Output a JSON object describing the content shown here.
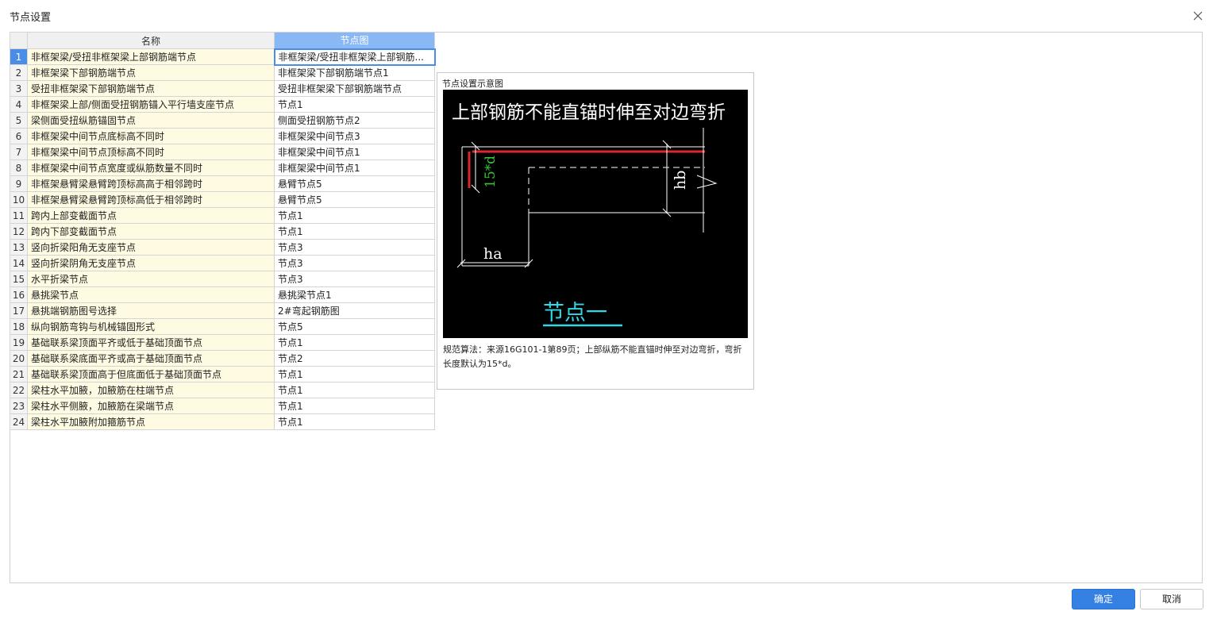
{
  "window": {
    "title": "节点设置",
    "close_icon": "close-icon"
  },
  "table": {
    "columns": [
      "名称",
      "节点图"
    ],
    "rows": [
      {
        "index": "1",
        "name": "非框架梁/受扭非框架梁上部钢筋端节点",
        "node": "非框架梁/受扭非框架梁上部钢筋..."
      },
      {
        "index": "2",
        "name": "非框架梁下部钢筋端节点",
        "node": "非框架梁下部钢筋端节点1"
      },
      {
        "index": "3",
        "name": "受扭非框架梁下部钢筋端节点",
        "node": "受扭非框架梁下部钢筋端节点"
      },
      {
        "index": "4",
        "name": "非框架梁上部/侧面受扭钢筋锚入平行墙支座节点",
        "node": "节点1"
      },
      {
        "index": "5",
        "name": "梁侧面受扭纵筋锚固节点",
        "node": "侧面受扭钢筋节点2"
      },
      {
        "index": "6",
        "name": "非框架梁中间节点底标高不同时",
        "node": "非框架梁中间节点3"
      },
      {
        "index": "7",
        "name": "非框架梁中间节点顶标高不同时",
        "node": "非框架梁中间节点1"
      },
      {
        "index": "8",
        "name": "非框架梁中间节点宽度或纵筋数量不同时",
        "node": "非框架梁中间节点1"
      },
      {
        "index": "9",
        "name": "非框架悬臂梁悬臂跨顶标高高于相邻跨时",
        "node": "悬臂节点5"
      },
      {
        "index": "10",
        "name": "非框架悬臂梁悬臂跨顶标高低于相邻跨时",
        "node": "悬臂节点5"
      },
      {
        "index": "11",
        "name": "跨内上部变截面节点",
        "node": "节点1"
      },
      {
        "index": "12",
        "name": "跨内下部变截面节点",
        "node": "节点1"
      },
      {
        "index": "13",
        "name": "竖向折梁阳角无支座节点",
        "node": "节点3"
      },
      {
        "index": "14",
        "name": "竖向折梁阴角无支座节点",
        "node": "节点3"
      },
      {
        "index": "15",
        "name": "水平折梁节点",
        "node": "节点3"
      },
      {
        "index": "16",
        "name": "悬挑梁节点",
        "node": "悬挑梁节点1"
      },
      {
        "index": "17",
        "name": "悬挑端钢筋图号选择",
        "node": "2#弯起钢筋图"
      },
      {
        "index": "18",
        "name": "纵向钢筋弯钩与机械锚固形式",
        "node": "节点5"
      },
      {
        "index": "19",
        "name": "基础联系梁顶面平齐或低于基础顶面节点",
        "node": "节点1"
      },
      {
        "index": "20",
        "name": "基础联系梁底面平齐或高于基础顶面节点",
        "node": "节点2"
      },
      {
        "index": "21",
        "name": "基础联系梁顶面高于但底面低于基础顶面节点",
        "node": "节点1"
      },
      {
        "index": "22",
        "name": "梁柱水平加腋，加腋筋在柱端节点",
        "node": "节点1"
      },
      {
        "index": "23",
        "name": "梁柱水平侧腋，加腋筋在梁端节点",
        "node": "节点1"
      },
      {
        "index": "24",
        "name": "梁柱水平加腋附加箍筋节点",
        "node": "节点1"
      }
    ]
  },
  "preview": {
    "title": "节点设置示意图",
    "diagram": {
      "heading": "上部钢筋不能直锚时伸至对边弯折",
      "label_15d": "15*d",
      "label_hb": "hb",
      "label_ha": "ha",
      "caption": "节点一",
      "colors": {
        "background": "#000000",
        "lines": "#ffffff",
        "rebar": "#e0262b",
        "dim_green": "#34c934",
        "caption": "#2fd8e6"
      }
    },
    "description": "规范算法：来源16G101-1第89页；上部纵筋不能直锚时伸至对边弯折，弯折长度默认为15*d。"
  },
  "buttons": {
    "ok": "确定",
    "cancel": "取消"
  },
  "colors": {
    "accent": "#3481e3",
    "header_selected": "#8ab8f5",
    "name_cell": "#fffbe2"
  }
}
